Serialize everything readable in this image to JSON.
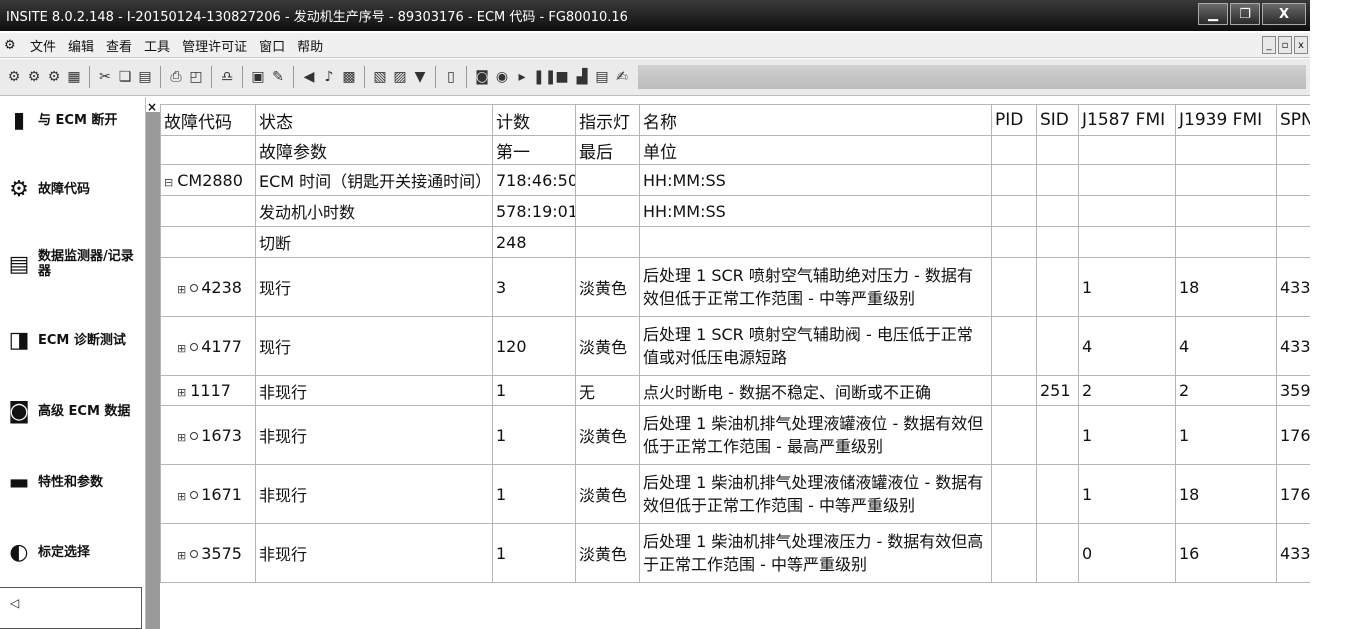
{
  "window": {
    "title": "INSITE 8.0.2.148  - I-20150124-130827206 - 发动机生产序号 - 89303176 - ECM 代码 - FG80010.16",
    "buttons": {
      "minimize": "▁",
      "restore": "❐",
      "close": "X"
    }
  },
  "menubar": {
    "items": [
      "文件",
      "编辑",
      "查看",
      "工具",
      "管理许可证",
      "窗口",
      "帮助"
    ],
    "mdi_buttons": [
      "_",
      "▫",
      "x"
    ]
  },
  "toolbar": {
    "icons": [
      "connect-icon",
      "disconnect-icon",
      "reconnect-icon",
      "properties-icon",
      "cut-icon",
      "copy-icon",
      "paste-icon",
      "print-icon",
      "print-preview-icon",
      "find-icon",
      "export-icon",
      "tools-icon",
      "speaker-icon",
      "settings-icon",
      "save-icon",
      "open-icon",
      "document-icon",
      "filter-icon",
      "page-icon",
      "camera-icon",
      "record-icon",
      "play-icon",
      "pause-icon",
      "stop-icon",
      "chart-icon",
      "report-icon",
      "edit-icon"
    ]
  },
  "sidebar": {
    "close_label": "×",
    "items": [
      {
        "label": "与 ECM 断开",
        "icon": "disconnect-icon"
      },
      {
        "label": "故障代码",
        "icon": "gears-icon"
      },
      {
        "label": "数据监测器/记录器",
        "icon": "monitor-icon"
      },
      {
        "label": "ECM 诊断测试",
        "icon": "diagnostic-icon"
      },
      {
        "label": "高级 ECM 数据",
        "icon": "advanced-data-icon"
      },
      {
        "label": "特性和参数",
        "icon": "features-icon"
      },
      {
        "label": "标定选择",
        "icon": "calibration-icon"
      }
    ],
    "bottom_item": "◁"
  },
  "grid": {
    "headers": [
      "故障代码",
      "状态",
      "计数",
      "指示灯",
      "名称",
      "PID",
      "SID",
      "J1587 FMI",
      "J1939 FMI",
      "SPN"
    ],
    "subheaders": [
      "",
      "故障参数",
      "第一",
      "最后",
      "单位",
      "",
      "",
      "",
      "",
      ""
    ],
    "param_rows": [
      {
        "code": "CM2880",
        "status": "ECM 时间（钥匙开关接通时间）",
        "count": "718:46:50",
        "lamp": "",
        "name": "HH:MM:SS"
      },
      {
        "code": "",
        "status": "发动机小时数",
        "count": "578:19:01",
        "lamp": "",
        "name": "HH:MM:SS"
      },
      {
        "code": "",
        "status": "切断",
        "count": "248",
        "lamp": "",
        "name": ""
      }
    ],
    "fault_rows": [
      {
        "code": "4238",
        "status": "现行",
        "count": "3",
        "lamp": "淡黄色",
        "name": "后处理 1 SCR 喷射空气辅助绝对压力 - 数据有效但低于正常工作范围 - 中等严重级别",
        "pid": "",
        "sid": "",
        "j1587": "1",
        "j1939": "18",
        "spn": "433"
      },
      {
        "code": "4177",
        "status": "现行",
        "count": "120",
        "lamp": "淡黄色",
        "name": "后处理 1 SCR 喷射空气辅助阀 - 电压低于正常值或对低压电源短路",
        "pid": "",
        "sid": "",
        "j1587": "4",
        "j1939": "4",
        "spn": "433"
      },
      {
        "code": "1117",
        "status": "非现行",
        "count": "1",
        "lamp": "无",
        "name": "点火时断电 - 数据不稳定、间断或不正确",
        "pid": "",
        "sid": "251",
        "j1587": "2",
        "j1939": "2",
        "spn": "359"
      },
      {
        "code": "1673",
        "status": "非现行",
        "count": "1",
        "lamp": "淡黄色",
        "name": "后处理 1 柴油机排气处理液罐液位 - 数据有效但低于正常工作范围 - 最高严重级别",
        "pid": "",
        "sid": "",
        "j1587": "1",
        "j1939": "1",
        "spn": "176"
      },
      {
        "code": "1671",
        "status": "非现行",
        "count": "1",
        "lamp": "淡黄色",
        "name": "后处理 1 柴油机排气处理液储液罐液位 - 数据有效但低于正常工作范围 - 中等严重级别",
        "pid": "",
        "sid": "",
        "j1587": "1",
        "j1939": "18",
        "spn": "176"
      },
      {
        "code": "3575",
        "status": "非现行",
        "count": "1",
        "lamp": "淡黄色",
        "name": "后处理 1 柴油机排气处理液压力 - 数据有效但高于正常工作范围 - 中等严重级别",
        "pid": "",
        "sid": "",
        "j1587": "0",
        "j1939": "16",
        "spn": "433"
      }
    ]
  }
}
